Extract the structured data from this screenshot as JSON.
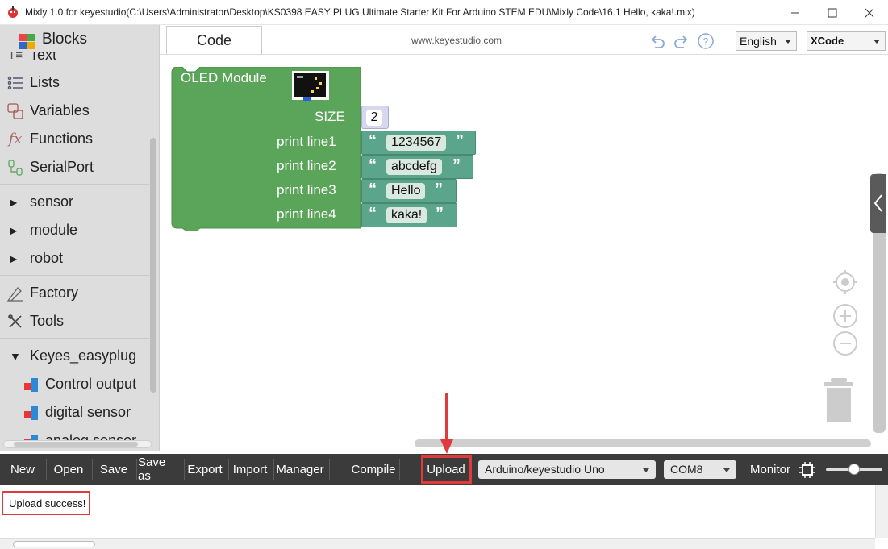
{
  "window": {
    "title": "Mixly 1.0 for keyestudio(C:\\Users\\Administrator\\Desktop\\KS0398 EASY PLUG Ultimate Starter Kit For Arduino STEM EDU\\Mixly Code\\16.1 Hello, kaka!.mix)",
    "controls": [
      "minimize-icon",
      "maximize-icon",
      "close-icon"
    ]
  },
  "sidebar": {
    "header": "Blocks",
    "items": [
      {
        "label": "Text",
        "icon": "text-icon"
      },
      {
        "label": "Lists",
        "icon": "list-icon"
      },
      {
        "label": "Variables",
        "icon": "variables-icon"
      },
      {
        "label": "Functions",
        "icon": "function-icon"
      },
      {
        "label": "SerialPort",
        "icon": "serial-port-icon"
      },
      {
        "label": "sensor",
        "icon": "triangle-right-icon"
      },
      {
        "label": "module",
        "icon": "triangle-right-icon"
      },
      {
        "label": "robot",
        "icon": "triangle-right-icon"
      },
      {
        "label": "Factory",
        "icon": "factory-icon"
      },
      {
        "label": "Tools",
        "icon": "tools-icon"
      },
      {
        "label": "Keyes_easyplug",
        "icon": "triangle-down-icon"
      },
      {
        "label": "Control output",
        "icon": "blocks-cube-icon"
      },
      {
        "label": "digital sensor",
        "icon": "blocks-cube-icon"
      },
      {
        "label": "analog sensor",
        "icon": "blocks-cube-icon"
      }
    ]
  },
  "workspace": {
    "tab": "Code",
    "website": "www.keyestudio.com",
    "language": "English",
    "ide_select": "XCode",
    "block": {
      "title": "OLED Module",
      "size_label": "SIZE",
      "size_value": "2",
      "lines": [
        {
          "label": "print line1",
          "value": "1234567"
        },
        {
          "label": "print line2",
          "value": "abcdefg"
        },
        {
          "label": "print line3",
          "value": "Hello"
        },
        {
          "label": "print line4",
          "value": "kaka!"
        }
      ],
      "quote_open": "“",
      "quote_close": "”"
    }
  },
  "toolbar": {
    "buttons": [
      "New",
      "Open",
      "Save",
      "Save as",
      "Export",
      "Import",
      "Manager",
      "Compile",
      "Upload"
    ],
    "board": "Arduino/keyestudio Uno",
    "port": "COM8",
    "monitor": "Monitor"
  },
  "output": {
    "message": "Upload success!"
  },
  "colors": {
    "block_green": "#5ba55b",
    "string_green": "#5ba58c",
    "toolbar_bg": "#3b3b3b",
    "highlight_red": "#e03a3a"
  }
}
